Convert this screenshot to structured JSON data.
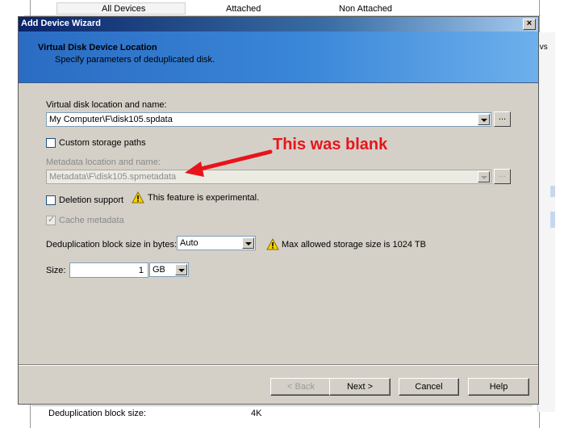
{
  "background_app": {
    "tabs": [
      "All Devices",
      "Attached",
      "Non Attached"
    ],
    "right_fragment": ":vs",
    "bottom_label": "Deduplication block size:",
    "bottom_value": "4K"
  },
  "dialog": {
    "title": "Add Device Wizard",
    "close_glyph": "×",
    "header": {
      "title": "Virtual Disk Device Location",
      "subtitle": "Specify parameters of deduplicated disk."
    },
    "disk_location": {
      "label": "Virtual disk location and name:",
      "value": "My Computer\\F\\disk105.spdata",
      "browse_label": "..."
    },
    "custom_storage": {
      "label": "Custom storage paths",
      "checked": false
    },
    "metadata_location": {
      "label": "Metadata location and name:",
      "value": "Metadata\\F\\disk105.spmetadata",
      "browse_label": "...",
      "disabled": true
    },
    "deletion_support": {
      "label": "Deletion support",
      "checked": false,
      "warning": "This feature is experimental."
    },
    "cache_metadata": {
      "label": "Cache metadata",
      "checked": true,
      "disabled": true,
      "tick": "✓"
    },
    "dedup_block_size": {
      "label": "Deduplication block size in bytes:",
      "value": "Auto",
      "warning": "Max allowed storage size is 1024 TB"
    },
    "size": {
      "label": "Size:",
      "value": "1",
      "unit": "GB"
    },
    "buttons": {
      "back": "< Back",
      "next": "Next >",
      "cancel": "Cancel",
      "help": "Help"
    }
  },
  "annotation": {
    "text": "This was blank",
    "color": "#e8141b"
  },
  "colors": {
    "header_blue": "#3a86d8",
    "dialog_bg": "#d4d0c8",
    "warning_yellow": "#f5d400"
  }
}
